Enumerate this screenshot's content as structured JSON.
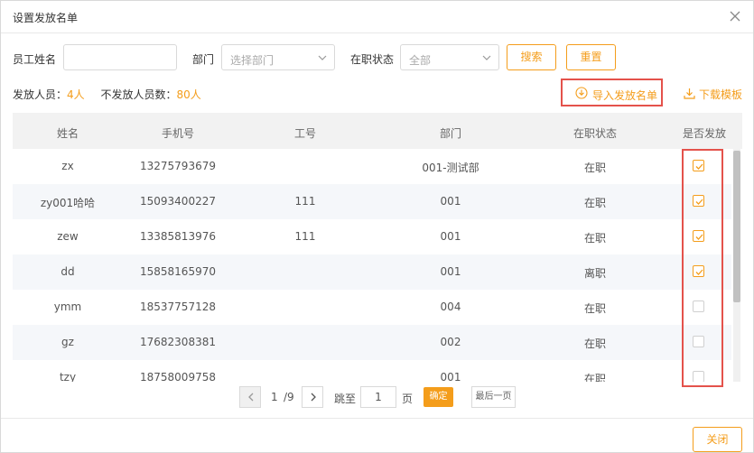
{
  "dialog": {
    "title": "设置发放名单"
  },
  "filters": {
    "name_label": "员工姓名",
    "name_value": "",
    "dept_label": "部门",
    "dept_placeholder": "选择部门",
    "status_label": "在职状态",
    "status_value": "全部",
    "search_label": "搜索",
    "reset_label": "重置"
  },
  "stats": {
    "issued_label": "发放人员：",
    "issued_count": "4人",
    "not_issued_label": "不发放人员数：",
    "not_issued_count": "80人"
  },
  "actions": {
    "import_label": "导入发放名单",
    "template_label": "下载模板"
  },
  "table": {
    "columns": [
      "姓名",
      "手机号",
      "工号",
      "部门",
      "在职状态",
      "是否发放"
    ],
    "rows": [
      {
        "name": "zx",
        "phone": "13275793679",
        "emp_no": "",
        "dept": "001-测试部",
        "status": "在职",
        "issued": true
      },
      {
        "name": "zy001哈哈",
        "phone": "15093400227",
        "emp_no": "111",
        "dept": "001",
        "status": "在职",
        "issued": true
      },
      {
        "name": "zew",
        "phone": "13385813976",
        "emp_no": "111",
        "dept": "001",
        "status": "在职",
        "issued": true
      },
      {
        "name": "dd",
        "phone": "15858165970",
        "emp_no": "",
        "dept": "001",
        "status": "离职",
        "issued": true
      },
      {
        "name": "ymm",
        "phone": "18537757128",
        "emp_no": "",
        "dept": "004",
        "status": "在职",
        "issued": false
      },
      {
        "name": "gz",
        "phone": "17682308381",
        "emp_no": "",
        "dept": "002",
        "status": "在职",
        "issued": false
      },
      {
        "name": "tzy",
        "phone": "18758009758",
        "emp_no": "",
        "dept": "001",
        "status": "在职",
        "issued": false
      }
    ]
  },
  "pagination": {
    "current": "1",
    "total": "/9",
    "jump_label": "跳至",
    "jump_value": "1",
    "page_unit": "页",
    "confirm_label": "确定",
    "last_label": "最后一页"
  },
  "footer": {
    "close_label": "关闭"
  },
  "colors": {
    "accent": "#f49d1b",
    "highlight": "#e4524b"
  },
  "icons": {
    "close": "close-icon",
    "dropdown": "chevron-down-icon",
    "import": "download-circle-icon",
    "template": "download-icon",
    "prev": "chevron-left-icon",
    "next": "chevron-right-icon",
    "check": "check-icon"
  }
}
